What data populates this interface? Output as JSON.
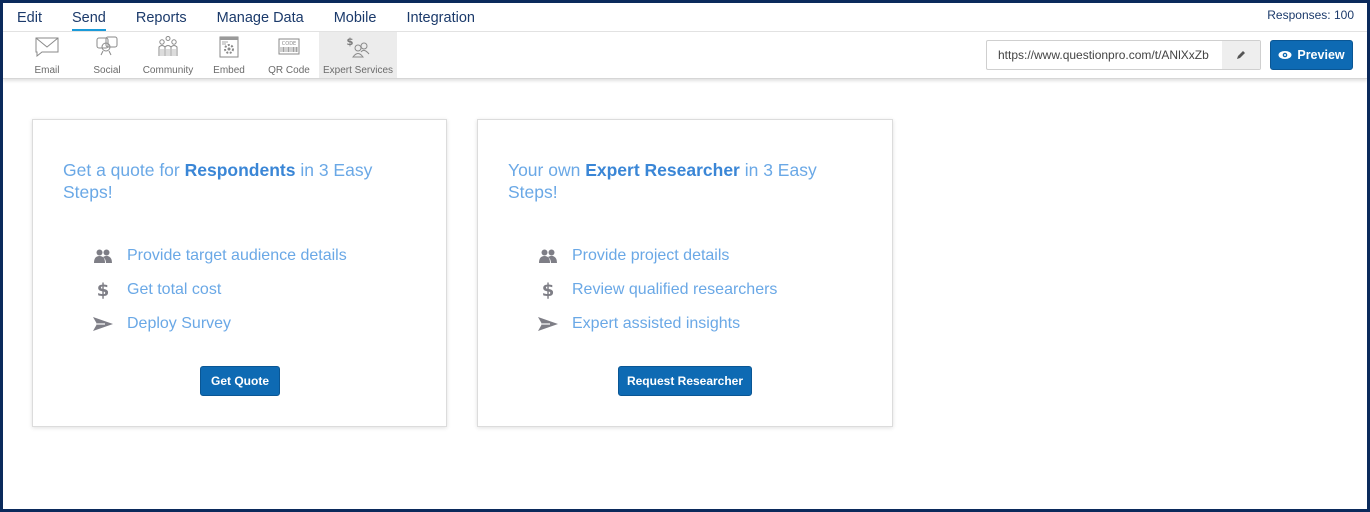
{
  "topnav": {
    "menu": [
      {
        "label": "Edit",
        "active": false
      },
      {
        "label": "Send",
        "active": true
      },
      {
        "label": "Reports",
        "active": false
      },
      {
        "label": "Manage Data",
        "active": false
      },
      {
        "label": "Mobile",
        "active": false
      },
      {
        "label": "Integration",
        "active": false
      }
    ],
    "responses": "Responses: 100"
  },
  "toolbar": {
    "tools": [
      {
        "label": "Email",
        "icon": "envelope-icon",
        "active": false
      },
      {
        "label": "Social",
        "icon": "social-chat-icon",
        "active": false
      },
      {
        "label": "Community",
        "icon": "community-people-icon",
        "active": false
      },
      {
        "label": "Embed",
        "icon": "embed-gear-icon",
        "active": false
      },
      {
        "label": "QR Code",
        "icon": "qr-code-icon",
        "active": false
      },
      {
        "label": "Expert Services",
        "icon": "expert-services-icon",
        "active": true
      }
    ],
    "survey_url": "https://www.questionpro.com/t/ANlXxZb",
    "edit_icon": "pencil-icon",
    "preview_label": "Preview",
    "preview_icon": "eye-icon"
  },
  "cards": [
    {
      "title_pre": "Get a quote for ",
      "title_bold": "Respondents",
      "title_post": " in 3 Easy Steps!",
      "steps": [
        {
          "icon": "users-icon",
          "text": "Provide target audience details"
        },
        {
          "icon": "dollar-icon",
          "text": "Get total cost"
        },
        {
          "icon": "send-icon",
          "text": "Deploy Survey"
        }
      ],
      "button": "Get Quote"
    },
    {
      "title_pre": "Your own ",
      "title_bold": "Expert Researcher",
      "title_post": " in 3 Easy Steps!",
      "steps": [
        {
          "icon": "users-icon",
          "text": "Provide project details"
        },
        {
          "icon": "dollar-icon",
          "text": "Review qualified researchers"
        },
        {
          "icon": "send-icon",
          "text": "Expert assisted insights"
        }
      ],
      "button": "Request Researcher"
    }
  ],
  "colors": {
    "frame": "#0b2a5c",
    "primary_button": "#0e6ab3",
    "title_light": "#6aa8e6",
    "title_bold": "#3a86d6",
    "nav_text": "#1b3a6b",
    "active_underline": "#1a9ad9"
  }
}
